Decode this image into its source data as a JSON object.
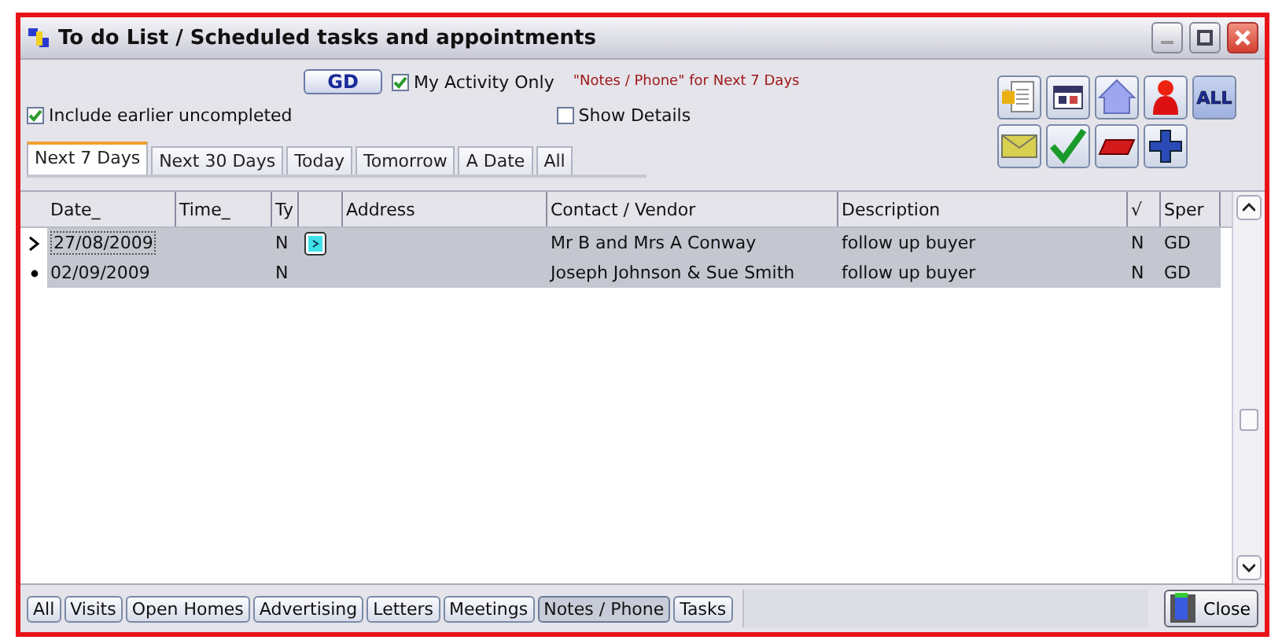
{
  "window": {
    "title": "To do List / Scheduled tasks and appointments"
  },
  "user_button": "GD",
  "options": [
    {
      "label": "My Activity Only",
      "checked": true
    },
    {
      "label": "Include earlier uncompleted",
      "checked": true
    },
    {
      "label": "Show Details",
      "checked": false
    }
  ],
  "filter_note": "\"Notes / Phone\" for Next 7 Days",
  "tabs": [
    {
      "label": "Next 7 Days",
      "selected": true
    },
    {
      "label": "Next 30 Days",
      "selected": false
    },
    {
      "label": "Today",
      "selected": false
    },
    {
      "label": "Tomorrow",
      "selected": false
    },
    {
      "label": "A Date",
      "selected": false
    },
    {
      "label": "All",
      "selected": false
    }
  ],
  "toolbar": [
    {
      "kind": "document"
    },
    {
      "kind": "calendar"
    },
    {
      "kind": "home"
    },
    {
      "kind": "person"
    },
    {
      "kind": "all",
      "label": "ALL"
    },
    {
      "kind": "mail"
    },
    {
      "kind": "tick"
    },
    {
      "kind": "eraser"
    },
    {
      "kind": "plus"
    }
  ],
  "table": {
    "columns": [
      "Date_",
      "Time_",
      "Ty",
      "",
      "Address",
      "Contact / Vendor",
      "Description",
      "√",
      "Sper"
    ],
    "rows": [
      {
        "current": true,
        "attachment": true,
        "cells": [
          "27/08/2009",
          "",
          "N",
          "",
          "",
          "Mr B and Mrs A Conway",
          "follow up buyer",
          "N",
          "GD"
        ]
      },
      {
        "current": false,
        "attachment": false,
        "cells": [
          "02/09/2009",
          "",
          "N",
          "",
          "",
          "Joseph Johnson & Sue Smith",
          "follow up buyer",
          "N",
          "GD"
        ]
      }
    ]
  },
  "categories": [
    {
      "label": "All",
      "selected": false
    },
    {
      "label": "Visits",
      "selected": false
    },
    {
      "label": "Open Homes",
      "selected": false
    },
    {
      "label": "Advertising",
      "selected": false
    },
    {
      "label": "Letters",
      "selected": false
    },
    {
      "label": "Meetings",
      "selected": false
    },
    {
      "label": "Notes / Phone",
      "selected": true
    },
    {
      "label": "Tasks",
      "selected": false
    }
  ],
  "close_button": "Close"
}
